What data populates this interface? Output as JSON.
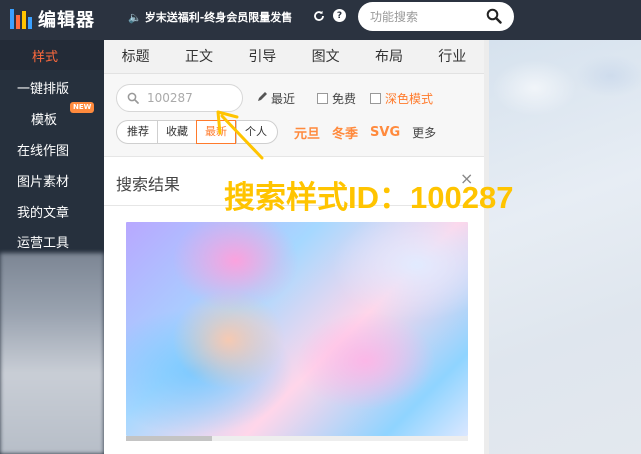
{
  "topbar": {
    "logo_text": "编辑器",
    "promo_text": "岁末送福利-终身会员限量发售",
    "search_placeholder": "功能搜索",
    "logo_colors": [
      "#3aa0ff",
      "#ff6a3d",
      "#ffc400"
    ]
  },
  "sidebar": {
    "items": [
      {
        "label": "样式",
        "active": true
      },
      {
        "label": "一键排版"
      },
      {
        "label": "模板",
        "badge": "NEW"
      },
      {
        "label": "在线作图"
      },
      {
        "label": "图片素材"
      },
      {
        "label": "我的文章"
      },
      {
        "label": "运营工具"
      }
    ]
  },
  "tabs": [
    "标题",
    "正文",
    "引导",
    "图文",
    "布局",
    "行业"
  ],
  "filters": {
    "search_value": "100287",
    "recent": "最近",
    "free": "免费",
    "dark_mode": "深色模式"
  },
  "segments": [
    {
      "label": "推荐"
    },
    {
      "label": "收藏"
    },
    {
      "label": "最新",
      "active": true
    },
    {
      "label": "个人"
    }
  ],
  "hot_tags": [
    "元旦",
    "冬季",
    "SVG"
  ],
  "more": "更多",
  "result": {
    "title": "搜索结果",
    "close": "×"
  },
  "annotation": "搜索样式ID：100287",
  "colors": {
    "accent": "#ff7a2b",
    "annotation": "#ffc400",
    "sidebar_bg": "#26303d"
  }
}
